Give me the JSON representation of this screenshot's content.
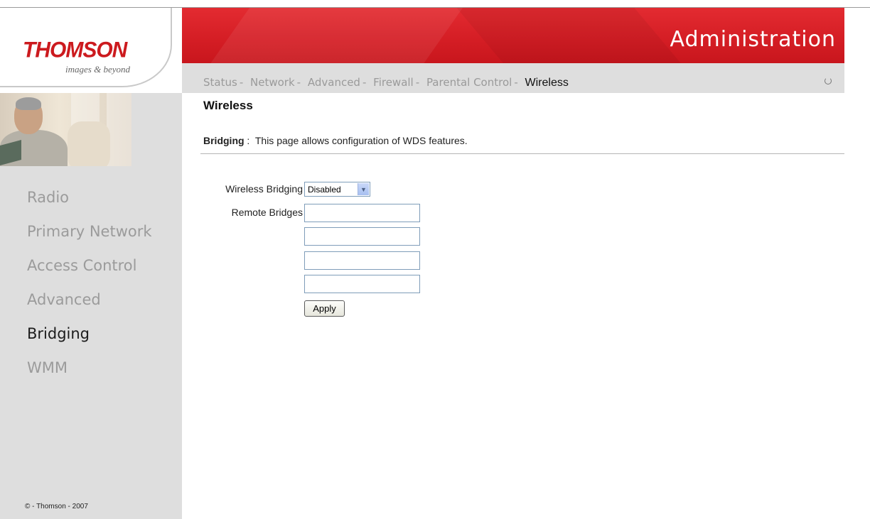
{
  "brand": {
    "logo_text": "THOMSON",
    "tagline": "images & beyond",
    "accent_color": "#d41d24"
  },
  "header": {
    "title": "Administration",
    "tabs": [
      {
        "label": "Status",
        "active": false
      },
      {
        "label": "Network",
        "active": false
      },
      {
        "label": "Advanced",
        "active": false
      },
      {
        "label": "Firewall",
        "active": false
      },
      {
        "label": "Parental Control",
        "active": false
      },
      {
        "label": "Wireless",
        "active": true
      }
    ],
    "separator": "-",
    "loader_icon": "spinner-icon"
  },
  "sidebar": {
    "items": [
      {
        "label": "Radio",
        "active": false
      },
      {
        "label": "Primary Network",
        "active": false
      },
      {
        "label": "Access Control",
        "active": false
      },
      {
        "label": "Advanced",
        "active": false
      },
      {
        "label": "Bridging",
        "active": true
      },
      {
        "label": "WMM",
        "active": false
      }
    ],
    "copyright": "© - Thomson - 2007"
  },
  "main": {
    "title": "Wireless",
    "description_label": "Bridging",
    "description_text": " :  This page allows configuration of WDS features.",
    "form": {
      "bridging_label": "Wireless Bridging",
      "bridging_value": "Disabled",
      "remote_label": "Remote Bridges",
      "remote_values": [
        "",
        "",
        "",
        ""
      ],
      "apply_label": "Apply"
    }
  }
}
